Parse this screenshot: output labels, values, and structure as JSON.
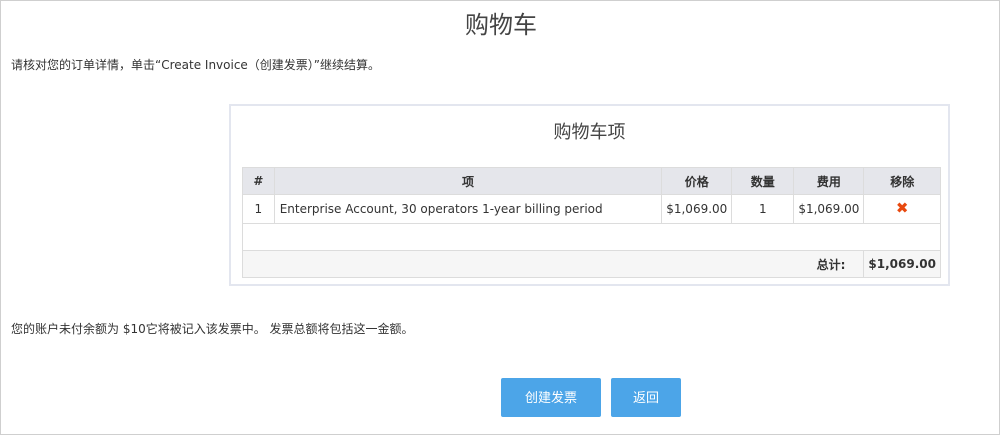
{
  "page": {
    "title": "购物车",
    "instruction": "请核对您的订单详情，单击“Create Invoice（创建发票）”继续结算。",
    "balance_note": "您的账户未付余额为 $10它将被记入该发票中。 发票总额将包括这一金额。"
  },
  "cart": {
    "title": "购物车项",
    "columns": {
      "num": "#",
      "item": "项",
      "price": "价格",
      "quantity": "数量",
      "fee": "费用",
      "remove": "移除"
    },
    "rows": [
      {
        "num": "1",
        "item": "Enterprise Account, 30 operators 1-year billing period",
        "price": "$1,069.00",
        "quantity": "1",
        "fee": "$1,069.00",
        "remove_icon": "close-x-icon"
      }
    ],
    "total_label": "总计:",
    "total_value": "$1,069.00"
  },
  "buttons": {
    "create_invoice": "创建发票",
    "back": "返回"
  },
  "colors": {
    "accent_button": "#4ca5e8",
    "remove_icon": "#e8490f",
    "table_header_bg": "#e5e6eb"
  }
}
